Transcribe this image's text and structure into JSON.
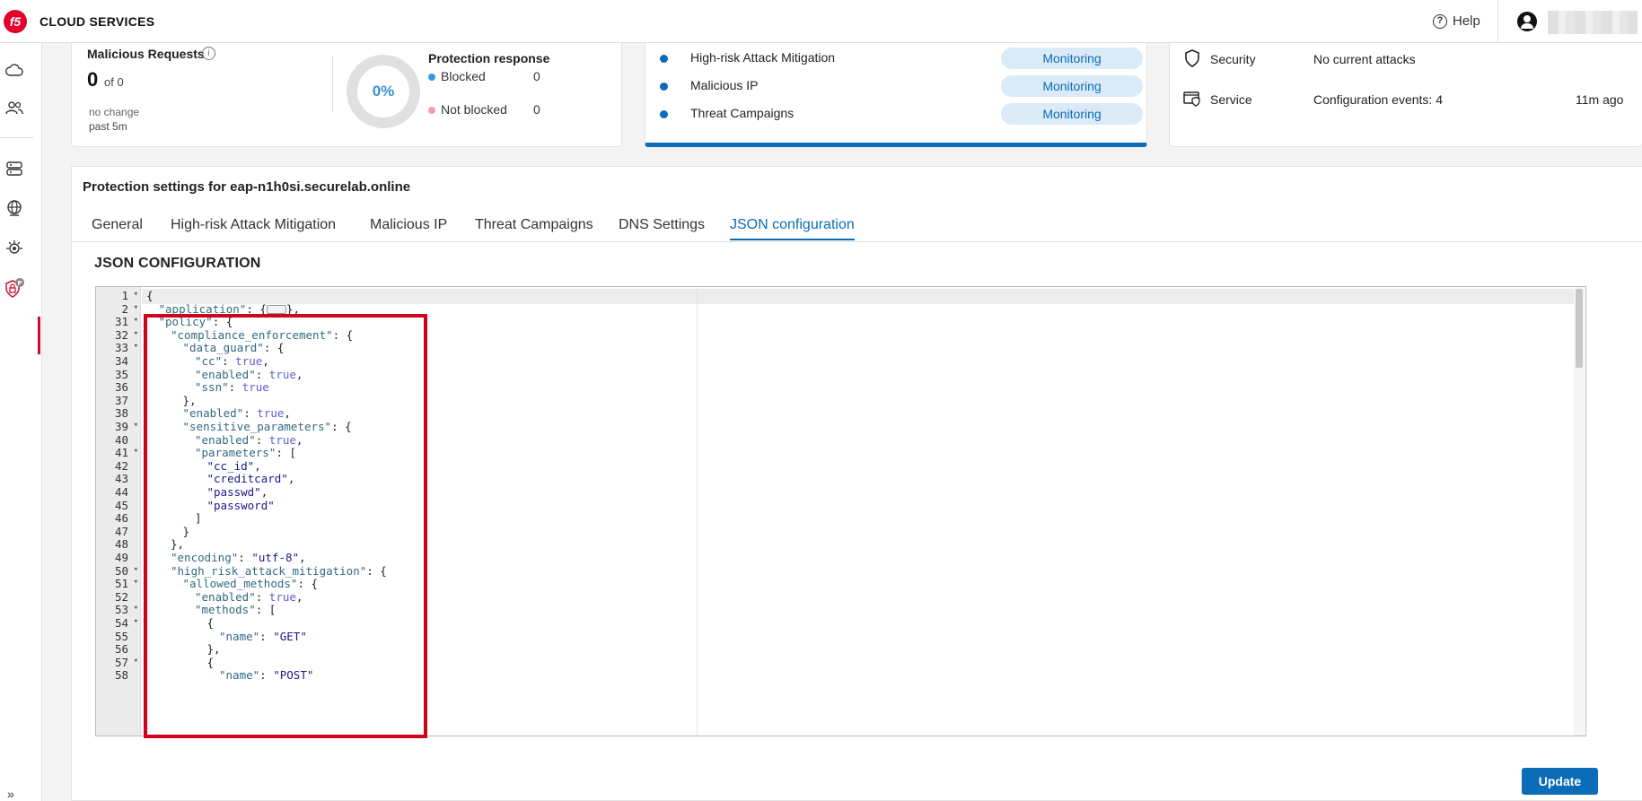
{
  "header": {
    "logo_text": "f5",
    "brand": "CLOUD SERVICES",
    "help_label": "Help"
  },
  "malicious_requests": {
    "title": "Malicious Requests",
    "info_icon": "i",
    "count": "0",
    "of_text": "of 0",
    "change": "no change",
    "period": "past 5m"
  },
  "protection_response": {
    "percent": "0%",
    "title": "Protection response",
    "rows": [
      {
        "label": "Blocked",
        "value": "0",
        "color": "#3a9ad9"
      },
      {
        "label": "Not blocked",
        "value": "0",
        "color": "#f0a0a8"
      }
    ]
  },
  "services": [
    {
      "label": "High-risk Attack Mitigation",
      "status": "Monitoring"
    },
    {
      "label": "Malicious IP",
      "status": "Monitoring"
    },
    {
      "label": "Threat Campaigns",
      "status": "Monitoring"
    }
  ],
  "status": [
    {
      "label": "Security",
      "value": "No current attacks",
      "time": ""
    },
    {
      "label": "Service",
      "value": "Configuration events: 4",
      "time": "11m ago"
    }
  ],
  "main": {
    "title": "Protection settings for eap-n1h0si.securelab.online",
    "tabs": [
      {
        "label": "General"
      },
      {
        "label": "High-risk Attack Mitigation"
      },
      {
        "label": "Malicious IP"
      },
      {
        "label": "Threat Campaigns"
      },
      {
        "label": "DNS Settings"
      },
      {
        "label": "JSON configuration"
      }
    ],
    "active_tab": "JSON configuration",
    "section_title": "JSON CONFIGURATION",
    "update_label": "Update"
  },
  "editor": {
    "lines": [
      {
        "n": "1",
        "fold": true,
        "indent": 0,
        "parts": [
          [
            "p",
            "{"
          ]
        ]
      },
      {
        "n": "2",
        "fold": true,
        "indent": 1,
        "parts": [
          [
            "k",
            "\"application\""
          ],
          [
            "p",
            ": {"
          ],
          [
            "badge",
            ""
          ],
          [
            "p",
            "},"
          ]
        ]
      },
      {
        "n": "31",
        "fold": true,
        "indent": 1,
        "parts": [
          [
            "k",
            "\"policy\""
          ],
          [
            "p",
            ": {"
          ]
        ]
      },
      {
        "n": "32",
        "fold": true,
        "indent": 2,
        "parts": [
          [
            "k",
            "\"compliance_enforcement\""
          ],
          [
            "p",
            ": {"
          ]
        ]
      },
      {
        "n": "33",
        "fold": true,
        "indent": 3,
        "parts": [
          [
            "k",
            "\"data_guard\""
          ],
          [
            "p",
            ": {"
          ]
        ]
      },
      {
        "n": "34",
        "fold": false,
        "indent": 4,
        "parts": [
          [
            "k",
            "\"cc\""
          ],
          [
            "p",
            ": "
          ],
          [
            "b",
            "true"
          ],
          [
            "p",
            ","
          ]
        ]
      },
      {
        "n": "35",
        "fold": false,
        "indent": 4,
        "parts": [
          [
            "k",
            "\"enabled\""
          ],
          [
            "p",
            ": "
          ],
          [
            "b",
            "true"
          ],
          [
            "p",
            ","
          ]
        ]
      },
      {
        "n": "36",
        "fold": false,
        "indent": 4,
        "parts": [
          [
            "k",
            "\"ssn\""
          ],
          [
            "p",
            ": "
          ],
          [
            "b",
            "true"
          ]
        ]
      },
      {
        "n": "37",
        "fold": false,
        "indent": 3,
        "parts": [
          [
            "p",
            "},"
          ]
        ]
      },
      {
        "n": "38",
        "fold": false,
        "indent": 3,
        "parts": [
          [
            "k",
            "\"enabled\""
          ],
          [
            "p",
            ": "
          ],
          [
            "b",
            "true"
          ],
          [
            "p",
            ","
          ]
        ]
      },
      {
        "n": "39",
        "fold": true,
        "indent": 3,
        "parts": [
          [
            "k",
            "\"sensitive_parameters\""
          ],
          [
            "p",
            ": {"
          ]
        ]
      },
      {
        "n": "40",
        "fold": false,
        "indent": 4,
        "parts": [
          [
            "k",
            "\"enabled\""
          ],
          [
            "p",
            ": "
          ],
          [
            "b",
            "true"
          ],
          [
            "p",
            ","
          ]
        ]
      },
      {
        "n": "41",
        "fold": true,
        "indent": 4,
        "parts": [
          [
            "k",
            "\"parameters\""
          ],
          [
            "p",
            ": ["
          ]
        ]
      },
      {
        "n": "42",
        "fold": false,
        "indent": 5,
        "parts": [
          [
            "s",
            "\"cc_id\""
          ],
          [
            "p",
            ","
          ]
        ]
      },
      {
        "n": "43",
        "fold": false,
        "indent": 5,
        "parts": [
          [
            "s",
            "\"creditcard\""
          ],
          [
            "p",
            ","
          ]
        ]
      },
      {
        "n": "44",
        "fold": false,
        "indent": 5,
        "parts": [
          [
            "s",
            "\"passwd\""
          ],
          [
            "p",
            ","
          ]
        ]
      },
      {
        "n": "45",
        "fold": false,
        "indent": 5,
        "parts": [
          [
            "s",
            "\"password\""
          ]
        ]
      },
      {
        "n": "46",
        "fold": false,
        "indent": 4,
        "parts": [
          [
            "p",
            "]"
          ]
        ]
      },
      {
        "n": "47",
        "fold": false,
        "indent": 3,
        "parts": [
          [
            "p",
            "}"
          ]
        ]
      },
      {
        "n": "48",
        "fold": false,
        "indent": 2,
        "parts": [
          [
            "p",
            "},"
          ]
        ]
      },
      {
        "n": "49",
        "fold": false,
        "indent": 2,
        "parts": [
          [
            "k",
            "\"encoding\""
          ],
          [
            "p",
            ": "
          ],
          [
            "s",
            "\"utf-8\""
          ],
          [
            "p",
            ","
          ]
        ]
      },
      {
        "n": "50",
        "fold": true,
        "indent": 2,
        "parts": [
          [
            "k",
            "\"high_risk_attack_mitigation\""
          ],
          [
            "p",
            ": {"
          ]
        ]
      },
      {
        "n": "51",
        "fold": true,
        "indent": 3,
        "parts": [
          [
            "k",
            "\"allowed_methods\""
          ],
          [
            "p",
            ": {"
          ]
        ]
      },
      {
        "n": "52",
        "fold": false,
        "indent": 4,
        "parts": [
          [
            "k",
            "\"enabled\""
          ],
          [
            "p",
            ": "
          ],
          [
            "b",
            "true"
          ],
          [
            "p",
            ","
          ]
        ]
      },
      {
        "n": "53",
        "fold": true,
        "indent": 4,
        "parts": [
          [
            "k",
            "\"methods\""
          ],
          [
            "p",
            ": ["
          ]
        ]
      },
      {
        "n": "54",
        "fold": true,
        "indent": 5,
        "parts": [
          [
            "p",
            "{"
          ]
        ]
      },
      {
        "n": "55",
        "fold": false,
        "indent": 6,
        "parts": [
          [
            "k",
            "\"name\""
          ],
          [
            "p",
            ": "
          ],
          [
            "s",
            "\"GET\""
          ]
        ]
      },
      {
        "n": "56",
        "fold": false,
        "indent": 5,
        "parts": [
          [
            "p",
            "},"
          ]
        ]
      },
      {
        "n": "57",
        "fold": true,
        "indent": 5,
        "parts": [
          [
            "p",
            "{"
          ]
        ]
      },
      {
        "n": "58",
        "fold": false,
        "indent": 6,
        "parts": [
          [
            "k",
            "\"name\""
          ],
          [
            "p",
            ": "
          ],
          [
            "s",
            "\"POST\""
          ]
        ]
      }
    ]
  },
  "icons": {
    "sidebar": [
      "cloud-icon",
      "users-icon",
      "server-icon",
      "globe-icon",
      "bug-icon",
      "shield-lock-icon"
    ],
    "status": [
      "shield-icon",
      "service-icon"
    ]
  },
  "colors": {
    "brand": "#e4002b",
    "accent": "#0b6cb7",
    "highlight": "#d0021b"
  }
}
